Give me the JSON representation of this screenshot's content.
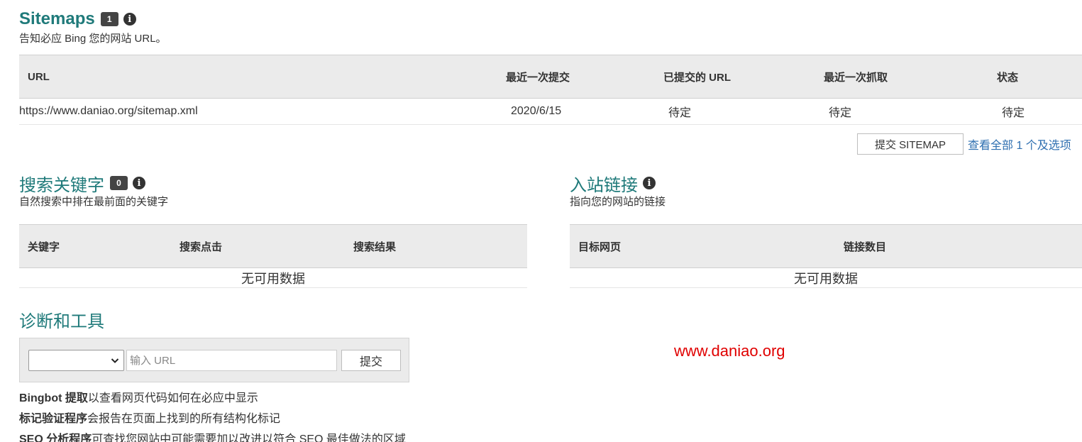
{
  "sitemaps": {
    "title": "Sitemaps",
    "badge": "1",
    "subtitle": "告知必应 Bing 您的网站 URL。",
    "columns": [
      "URL",
      "最近一次提交",
      "已提交的 URL",
      "最近一次抓取",
      "状态"
    ],
    "rows": [
      [
        "https://www.daniao.org/sitemap.xml",
        "2020/6/15",
        "待定",
        "待定",
        "待定"
      ]
    ],
    "submit_button": "提交 SITEMAP",
    "view_all_link": "查看全部 1 个及选项"
  },
  "keywords": {
    "title": "搜索关键字",
    "badge": "0",
    "subtitle": "自然搜索中排在最前面的关键字",
    "columns": [
      "关键字",
      "搜索点击",
      "搜索结果"
    ],
    "empty": "无可用数据"
  },
  "inbound": {
    "title": "入站链接",
    "subtitle": "指向您的网站的链接",
    "columns": [
      "目标网页",
      "链接数目"
    ],
    "empty": "无可用数据"
  },
  "tools": {
    "title": "诊断和工具",
    "select_value": "",
    "input_placeholder": "输入 URL",
    "submit_label": "提交",
    "items": [
      {
        "bold": "Bingbot 提取",
        "text": "以查看网页代码如何在必应中显示"
      },
      {
        "bold": "标记验证程序",
        "text": "会报告在页面上找到的所有结构化标记"
      },
      {
        "bold": "SEO 分析程序",
        "text": "可查找您网站中可能需要加以改进以符合 SEO 最佳做法的区域"
      }
    ]
  },
  "watermark": "www.daniao.org",
  "colors": {
    "heading": "#1f7a7a",
    "link": "#2e6fb0",
    "watermark": "#e00000",
    "header_bg": "#ebebeb"
  }
}
